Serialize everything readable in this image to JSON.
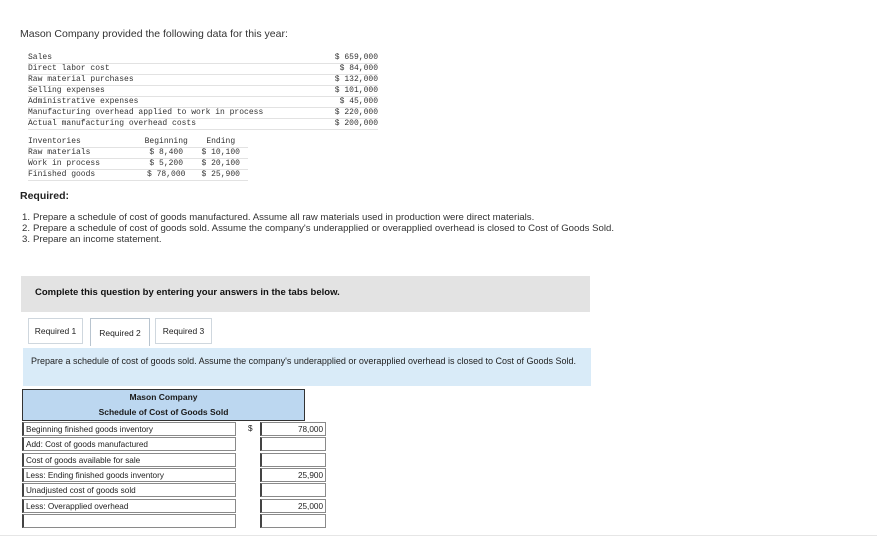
{
  "intro": "Mason Company provided the following data for this year:",
  "data_rows": [
    {
      "label": "Sales",
      "value": "$ 659,000"
    },
    {
      "label": "Direct labor cost",
      "value": "$ 84,000"
    },
    {
      "label": "Raw material purchases",
      "value": "$ 132,000"
    },
    {
      "label": "Selling expenses",
      "value": "$ 101,000"
    },
    {
      "label": "Administrative expenses",
      "value": "$ 45,000"
    },
    {
      "label": "Manufacturing overhead applied to work in process",
      "value": "$ 220,000"
    },
    {
      "label": "Actual manufacturing overhead costs",
      "value": "$ 200,000"
    }
  ],
  "inventories": {
    "headers": [
      "Inventories",
      "Beginning",
      "Ending"
    ],
    "rows": [
      {
        "name": "Raw materials",
        "beginning": "$ 8,400",
        "ending": "$ 10,100"
      },
      {
        "name": "Work in process",
        "beginning": "$ 5,200",
        "ending": "$ 20,100"
      },
      {
        "name": "Finished goods",
        "beginning": "$ 78,000",
        "ending": "$ 25,900"
      }
    ]
  },
  "required_heading": "Required:",
  "requirements": [
    {
      "num": "1.",
      "text": "Prepare a schedule of cost of goods manufactured. Assume all raw materials used in production were direct materials."
    },
    {
      "num": "2.",
      "text": "Prepare a schedule of cost of goods sold. Assume the company's underapplied or overapplied overhead is closed to Cost of Goods Sold."
    },
    {
      "num": "3.",
      "text": "Prepare an income statement."
    }
  ],
  "panel_text": "Complete this question by entering your answers in the tabs below.",
  "tabs": [
    "Required 1",
    "Required 2",
    "Required 3"
  ],
  "active_tab": "Required 2",
  "instruction": "Prepare a schedule of cost of goods sold. Assume the company's underapplied or overapplied overhead is closed to Cost of Goods Sold.",
  "schedule": {
    "company": "Mason Company",
    "title": "Schedule of Cost of Goods Sold",
    "rows": [
      {
        "label": "Beginning finished goods inventory",
        "dollar": "$",
        "value": "78,000"
      },
      {
        "label": "Add: Cost of goods manufactured",
        "dollar": "",
        "value": ""
      },
      {
        "label": "Cost of goods available for sale",
        "dollar": "",
        "value": ""
      },
      {
        "label": "Less: Ending finished goods inventory",
        "dollar": "",
        "value": "25,900"
      },
      {
        "label": "Unadjusted cost of goods sold",
        "dollar": "",
        "value": ""
      },
      {
        "label": "Less: Overapplied overhead",
        "dollar": "",
        "value": "25,000"
      },
      {
        "label": "",
        "dollar": "",
        "value": ""
      }
    ]
  },
  "colors": {
    "panel": "#e3e3e3",
    "instruction_bg": "#d9ebf8",
    "schedule_header": "#bcd7f0"
  }
}
